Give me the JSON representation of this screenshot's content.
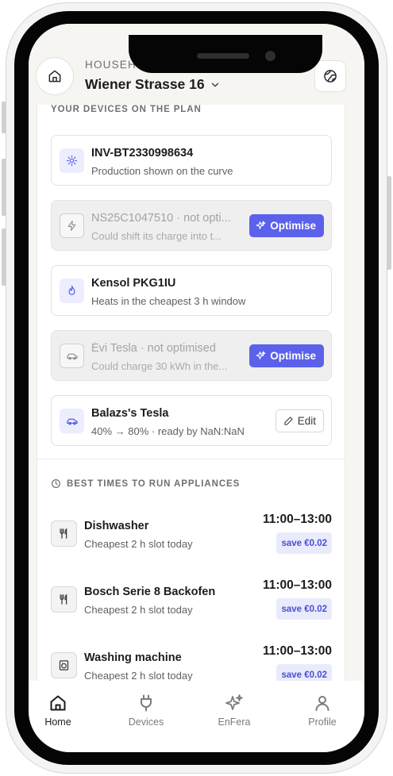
{
  "header": {
    "household_label": "HOUSEHOLD",
    "household_name": "Wiener Strasse 16"
  },
  "devices": {
    "section_title": "YOUR DEVICES ON THE PLAN",
    "items": [
      {
        "name": "INV-BT2330998634",
        "subtitle": "Production shown on the curve",
        "icon": "sun-icon",
        "state": "on-plan",
        "action": ""
      },
      {
        "name": "NS25C1047510 · not opti...",
        "subtitle": "Could shift its charge into t...",
        "icon": "bolt-icon",
        "state": "not-optimised",
        "action": "Optimise"
      },
      {
        "name": "Kensol PKG1IU",
        "subtitle": "Heats in the cheapest 3 h window",
        "icon": "flame-icon",
        "state": "on-plan",
        "action": ""
      },
      {
        "name": "Évi Tesla · not optimised",
        "subtitle": "Could charge 30 kWh in the...",
        "icon": "car-icon",
        "state": "not-optimised",
        "action": "Optimise"
      },
      {
        "name": "Balazs's Tesla",
        "subtitle": "40% → 80% · ready by NaN:NaN",
        "icon": "car-icon",
        "state": "on-plan",
        "action": "Edit"
      }
    ]
  },
  "appliances": {
    "section_title": "BEST TIMES TO RUN APPLIANCES",
    "items": [
      {
        "name": "Dishwasher",
        "subtitle": "Cheapest 2 h slot today",
        "time": "11:00–13:00",
        "saving": "save €0.02",
        "icon": "utensils-icon"
      },
      {
        "name": "Bosch Serie 8 Backofen",
        "subtitle": "Cheapest 2 h slot today",
        "time": "11:00–13:00",
        "saving": "save €0.02",
        "icon": "utensils-icon"
      },
      {
        "name": "Washing machine",
        "subtitle": "Cheapest 2 h slot today",
        "time": "11:00–13:00",
        "saving": "save €0.02",
        "icon": "washing-machine-icon"
      }
    ]
  },
  "nav": {
    "items": [
      {
        "label": "Home",
        "icon": "home-icon",
        "active": true
      },
      {
        "label": "Devices",
        "icon": "plug-icon",
        "active": false
      },
      {
        "label": "EnFera",
        "icon": "sparkles-icon",
        "active": false
      },
      {
        "label": "Profile",
        "icon": "user-icon",
        "active": false
      }
    ]
  },
  "colors": {
    "accent": "#5b61ea",
    "badge_bg": "#e9ebfd",
    "badge_text": "#4a4fd1",
    "screen_bg": "#f6f5f1"
  }
}
